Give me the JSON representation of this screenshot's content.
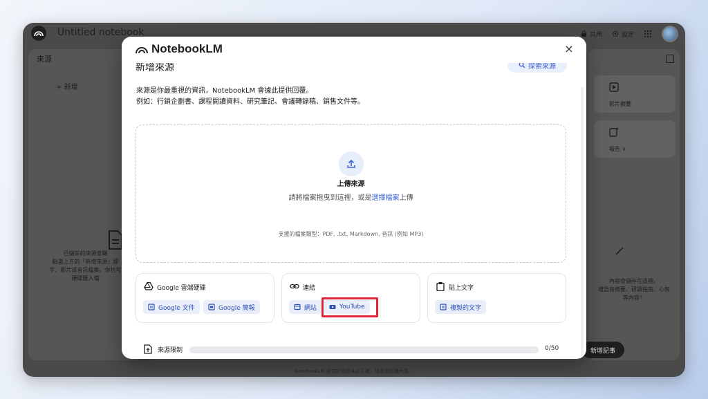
{
  "app": {
    "title": "Untitled notebook",
    "share_label": "共用",
    "settings_label": "設定",
    "sources_panel_title": "來源",
    "add_label": "新增",
    "empty_sources_text": [
      "已儲存的來源會顯",
      "點選上方的「新增來源」即",
      "字、影片或音訊檔案。你也可",
      "硬碟匯入檔"
    ],
    "right_cards": [
      {
        "label": "影片摘要"
      },
      {
        "label": "報告 ∨"
      }
    ],
    "right_empty_text": [
      "內容會儲存在這裡。",
      "增語音摘要、研讀指南、心智",
      "等內容！"
    ],
    "add_note_label": "新增記事",
    "footer_note": "NotebookLM 提供的資訊未必正確，請查證回覆內容。"
  },
  "modal": {
    "brand": "NotebookLM",
    "close_glyph": "×",
    "heading": "新增來源",
    "discover_label": "探索來源",
    "intro_line1": "來源是你最重視的資訊，NotebookLM 會據此提供回覆。",
    "intro_line2": "例如：行銷企劃書、課程閱讀資料、研究筆記、會議轉錄稿、銷售文件等。",
    "upload": {
      "title": "上傳來源",
      "hint_before": "請將檔案拖曳到這裡，或是",
      "hint_link": "選擇檔案",
      "hint_after": "上傳",
      "filetypes": "支援的檔案類型：PDF, .txt, Markdown, 音訊 (例如 MP3)"
    },
    "cards": {
      "drive": {
        "title": "Google 雲端硬碟",
        "chips": [
          "Google 文件",
          "Google 簡報"
        ]
      },
      "link": {
        "title": "連結",
        "chips": [
          "網站",
          "YouTube"
        ]
      },
      "paste": {
        "title": "貼上文字",
        "chips": [
          "複製的文字"
        ]
      }
    },
    "limit": {
      "label": "來源限制",
      "count": "0/50",
      "fraction": 0.0
    }
  },
  "colors": {
    "accent": "#3a66d6",
    "highlight": "#e1253a",
    "chip_bg": "#e9eef8"
  }
}
